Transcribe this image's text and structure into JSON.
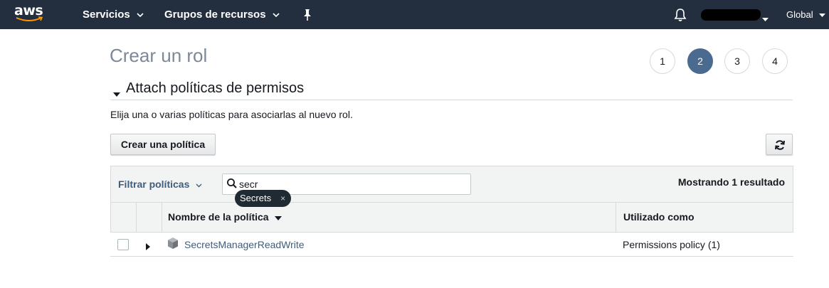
{
  "topnav": {
    "logo": "aws",
    "services_label": "Servicios",
    "resource_groups_label": "Grupos de recursos",
    "region_label": "Global",
    "icons": {
      "pin": "pin-icon",
      "bell": "bell-icon"
    }
  },
  "page": {
    "title": "Crear un rol",
    "steps": [
      "1",
      "2",
      "3",
      "4"
    ],
    "active_step": "2",
    "section_title": "Attach políticas de permisos",
    "section_description": "Elija una o varias políticas para asociarlas al nuevo rol.",
    "create_policy_button": "Crear una política"
  },
  "filter": {
    "dropdown_label": "Filtrar políticas",
    "search_value": "secr",
    "tooltip_label": "Secrets",
    "tooltip_close": "×",
    "results_text": "Mostrando 1 resultado"
  },
  "table": {
    "columns": [
      "Nombre de la política",
      "Utilizado como"
    ],
    "rows": [
      {
        "name": "SecretsManagerReadWrite",
        "used_as": "Permissions policy (1)"
      }
    ]
  },
  "colors": {
    "nav_bg": "#232f3e",
    "active_step": "#4a6a8f",
    "link": "#3f5d7c",
    "table_header_bg": "#f2f3f3"
  }
}
